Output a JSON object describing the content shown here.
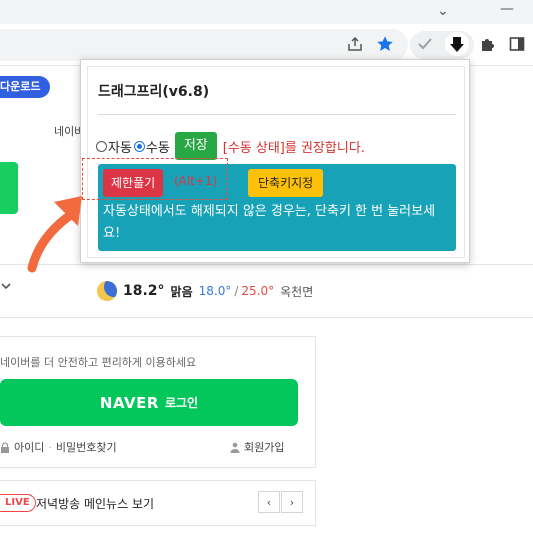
{
  "chrome": {
    "chevron_glyph": "⌄",
    "minimize_glyph": "—",
    "colors": {
      "star": "#1a73e8",
      "toolbar": "#ffffff",
      "tab_strip": "#f3f4f6"
    }
  },
  "page": {
    "download_label": "다운로드",
    "nav_fragment": "네이버",
    "weather": {
      "temp": "18.2°",
      "condition": "맑음",
      "low": "18.0°",
      "separator": "/",
      "high": "25.0°",
      "location": "옥천면"
    },
    "login_hint": "네이버를 더 안전하고 편리하게 이용하세요",
    "login_brand": "NAVER",
    "login_label": "로그인",
    "id_link": "아이디",
    "dot": "·",
    "pw_link": "비밀번호찾기",
    "join_link": "회원가입",
    "live_badge": "LIVE",
    "news_title": "저녁방송 메인뉴스 보기",
    "prev": "‹",
    "next": "›"
  },
  "popup": {
    "title": "드래그프리(v6.8)",
    "auto_label": "자동",
    "manual_label": "수동",
    "save_label": "저장",
    "recommend": "[수동 상태]를 권장합니다.",
    "release_label": "제한풀기",
    "shortcut_hint": "(Alt+1)",
    "set_shortcut_label": "단축키지정",
    "message": "자동상태에서도 해제되지 않은 경우는, 단축키 한 번 눌러보세요!",
    "colors": {
      "panel": "#17a2b8",
      "save": "#28a745",
      "release": "#dc3545",
      "shortcut": "#ffc107",
      "arrow": "#f26a3d"
    }
  }
}
